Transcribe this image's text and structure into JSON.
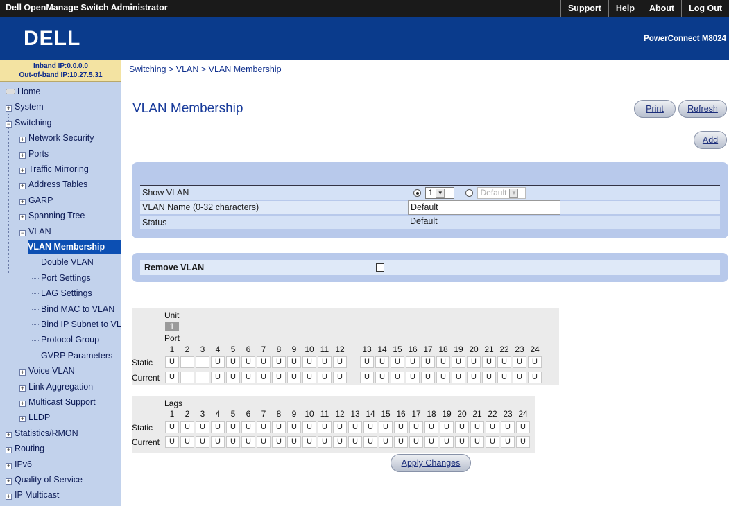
{
  "topbar": {
    "title": "Dell OpenManage Switch Administrator",
    "links": [
      "Support",
      "Help",
      "About",
      "Log Out"
    ]
  },
  "banner": {
    "logo": "DELL",
    "product": "PowerConnect M8024"
  },
  "ipinfo": {
    "inband": "Inband IP:0.0.0.0",
    "outofband": "Out-of-band IP:10.27.5.31"
  },
  "breadcrumb": "Switching > VLAN > VLAN Membership",
  "sidebar": {
    "items": [
      {
        "label": "Home",
        "icon": "home-icon"
      },
      {
        "label": "System",
        "icon": "plus-icon"
      },
      {
        "label": "Switching",
        "icon": "minus-icon"
      },
      {
        "label": "Network Security",
        "icon": "plus-icon"
      },
      {
        "label": "Ports",
        "icon": "plus-icon"
      },
      {
        "label": "Traffic Mirroring",
        "icon": "plus-icon"
      },
      {
        "label": "Address Tables",
        "icon": "plus-icon"
      },
      {
        "label": "GARP",
        "icon": "plus-icon"
      },
      {
        "label": "Spanning Tree",
        "icon": "plus-icon"
      },
      {
        "label": "VLAN",
        "icon": "minus-icon"
      },
      {
        "label": "VLAN Membership",
        "icon": ""
      },
      {
        "label": "Double VLAN",
        "icon": ""
      },
      {
        "label": "Port Settings",
        "icon": ""
      },
      {
        "label": "LAG Settings",
        "icon": ""
      },
      {
        "label": "Bind MAC to VLAN",
        "icon": ""
      },
      {
        "label": "Bind IP Subnet to VLAN",
        "icon": ""
      },
      {
        "label": "Protocol Group",
        "icon": ""
      },
      {
        "label": "GVRP Parameters",
        "icon": ""
      },
      {
        "label": "Voice VLAN",
        "icon": "plus-icon"
      },
      {
        "label": "Link Aggregation",
        "icon": "plus-icon"
      },
      {
        "label": "Multicast Support",
        "icon": "plus-icon"
      },
      {
        "label": "LLDP",
        "icon": "plus-icon"
      },
      {
        "label": "Statistics/RMON",
        "icon": "plus-icon"
      },
      {
        "label": "Routing",
        "icon": "plus-icon"
      },
      {
        "label": "IPv6",
        "icon": "plus-icon"
      },
      {
        "label": "Quality of Service",
        "icon": "plus-icon"
      },
      {
        "label": "IP Multicast",
        "icon": "plus-icon"
      }
    ]
  },
  "page": {
    "title": "VLAN Membership",
    "print": "Print",
    "refresh": "Refresh",
    "add": "Add"
  },
  "vlan": {
    "show_label": "Show VLAN",
    "show_value": "1",
    "show_alt": "Default",
    "name_label": "VLAN Name (0-32 characters)",
    "name_value": "Default",
    "status_label": "Status",
    "status_value": "Default",
    "remove_label": "Remove VLAN"
  },
  "ports": {
    "unit_label": "Unit",
    "unit_value": "1",
    "port_label": "Port",
    "static_label": "Static",
    "current_label": "Current",
    "numbers": [
      "1",
      "2",
      "3",
      "4",
      "5",
      "6",
      "7",
      "8",
      "9",
      "10",
      "11",
      "12",
      "13",
      "14",
      "15",
      "16",
      "17",
      "18",
      "19",
      "20",
      "21",
      "22",
      "23",
      "24"
    ],
    "static": [
      "U",
      "",
      "",
      "U",
      "U",
      "U",
      "U",
      "U",
      "U",
      "U",
      "U",
      "U",
      "U",
      "U",
      "U",
      "U",
      "U",
      "U",
      "U",
      "U",
      "U",
      "U",
      "U",
      "U"
    ],
    "current": [
      "U",
      "",
      "",
      "U",
      "U",
      "U",
      "U",
      "U",
      "U",
      "U",
      "U",
      "U",
      "U",
      "U",
      "U",
      "U",
      "U",
      "U",
      "U",
      "U",
      "U",
      "U",
      "U",
      "U"
    ]
  },
  "lags": {
    "label": "Lags",
    "static_label": "Static",
    "current_label": "Current",
    "numbers": [
      "1",
      "2",
      "3",
      "4",
      "5",
      "6",
      "7",
      "8",
      "9",
      "10",
      "11",
      "12",
      "13",
      "14",
      "15",
      "16",
      "17",
      "18",
      "19",
      "20",
      "21",
      "22",
      "23",
      "24"
    ],
    "static": [
      "U",
      "U",
      "U",
      "U",
      "U",
      "U",
      "U",
      "U",
      "U",
      "U",
      "U",
      "U",
      "U",
      "U",
      "U",
      "U",
      "U",
      "U",
      "U",
      "U",
      "U",
      "U",
      "U",
      "U"
    ],
    "current": [
      "U",
      "U",
      "U",
      "U",
      "U",
      "U",
      "U",
      "U",
      "U",
      "U",
      "U",
      "U",
      "U",
      "U",
      "U",
      "U",
      "U",
      "U",
      "U",
      "U",
      "U",
      "U",
      "U",
      "U"
    ]
  },
  "apply": "Apply Changes"
}
